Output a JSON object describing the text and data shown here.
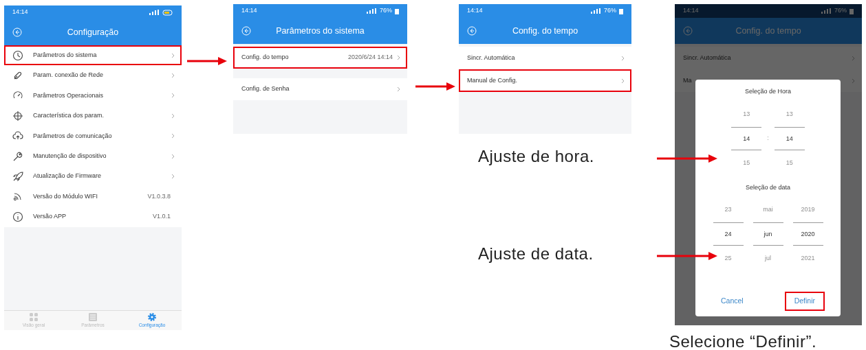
{
  "screens": [
    {
      "status_bar": {
        "time": "14:14"
      },
      "header": {
        "title": "Configuração"
      },
      "menu_items": [
        {
          "label": "Parâmetros do sistema",
          "kind": "link",
          "highlighted": true
        },
        {
          "label": "Param. conexão de Rede",
          "kind": "link",
          "highlighted": false
        },
        {
          "label": "Parâmetros Operacionais",
          "kind": "link",
          "highlighted": false
        },
        {
          "label": "Característica dos param.",
          "kind": "link",
          "highlighted": false
        },
        {
          "label": "Parâmetros de comunicação",
          "kind": "link",
          "highlighted": false
        },
        {
          "label": "Manutenção de dispositivo",
          "kind": "link",
          "highlighted": false
        },
        {
          "label": "Atualização de Firmware",
          "kind": "link",
          "highlighted": false
        },
        {
          "label": "Versão do Módulo WIFI",
          "kind": "info",
          "value": "V1.0.3.8",
          "highlighted": false
        },
        {
          "label": "Versão APP",
          "kind": "info",
          "value": "V1.0.1",
          "highlighted": false
        }
      ],
      "bottom_nav": [
        {
          "label": "Visão geral",
          "selected": false
        },
        {
          "label": "Parâmetros",
          "selected": false
        },
        {
          "label": "Configuração",
          "selected": true
        }
      ]
    },
    {
      "status_bar": {
        "time": "14:14",
        "battery": "76%"
      },
      "header": {
        "title": "Parâmetros do sistema"
      },
      "menu_items": [
        {
          "label": "Config. do tempo",
          "kind": "link",
          "value": "2020/6/24 14:14",
          "highlighted": true
        },
        {
          "label": "Config. de Senha",
          "kind": "link",
          "highlighted": false
        }
      ]
    },
    {
      "status_bar": {
        "time": "14:14",
        "battery": "76%"
      },
      "header": {
        "title": "Config. do tempo"
      },
      "menu_items": [
        {
          "label": "Sincr. Automática",
          "kind": "link",
          "highlighted": false
        },
        {
          "label": "Manual de Config.",
          "kind": "link",
          "highlighted": true
        }
      ]
    },
    {
      "status_bar": {
        "time": "14:14",
        "battery": "76%"
      },
      "header": {
        "title": "Config. do tempo"
      },
      "dimmed": true,
      "menu_items": [
        {
          "label": "Sincr. Automática",
          "kind": "link",
          "highlighted": false
        },
        {
          "label": "Ma",
          "kind": "link",
          "highlighted": false
        }
      ],
      "dialog": {
        "time_title": "Seleção de Hora",
        "separator": ":",
        "time_columns": [
          [
            {
              "text": "13",
              "selected": false
            },
            {
              "text": "14",
              "selected": true
            },
            {
              "text": "15",
              "selected": false
            }
          ],
          [
            {
              "text": "13",
              "selected": false
            },
            {
              "text": "14",
              "selected": true
            },
            {
              "text": "15",
              "selected": false
            }
          ]
        ],
        "date_title": "Seleção de data",
        "date_columns": [
          [
            {
              "text": "23",
              "selected": false
            },
            {
              "text": "24",
              "selected": true
            },
            {
              "text": "25",
              "selected": false
            }
          ],
          [
            {
              "text": "mai",
              "selected": false
            },
            {
              "text": "jun",
              "selected": true
            },
            {
              "text": "jul",
              "selected": false
            }
          ],
          [
            {
              "text": "2019",
              "selected": false
            },
            {
              "text": "2020",
              "selected": true
            },
            {
              "text": "2021",
              "selected": false
            }
          ]
        ],
        "buttons": [
          {
            "label": "Cancel",
            "highlighted": false
          },
          {
            "label": "Definir",
            "highlighted": true
          }
        ]
      }
    }
  ],
  "captions": [
    "Ajuste de hora.",
    "Ajuste de data.",
    "Selecione “Definir”."
  ]
}
